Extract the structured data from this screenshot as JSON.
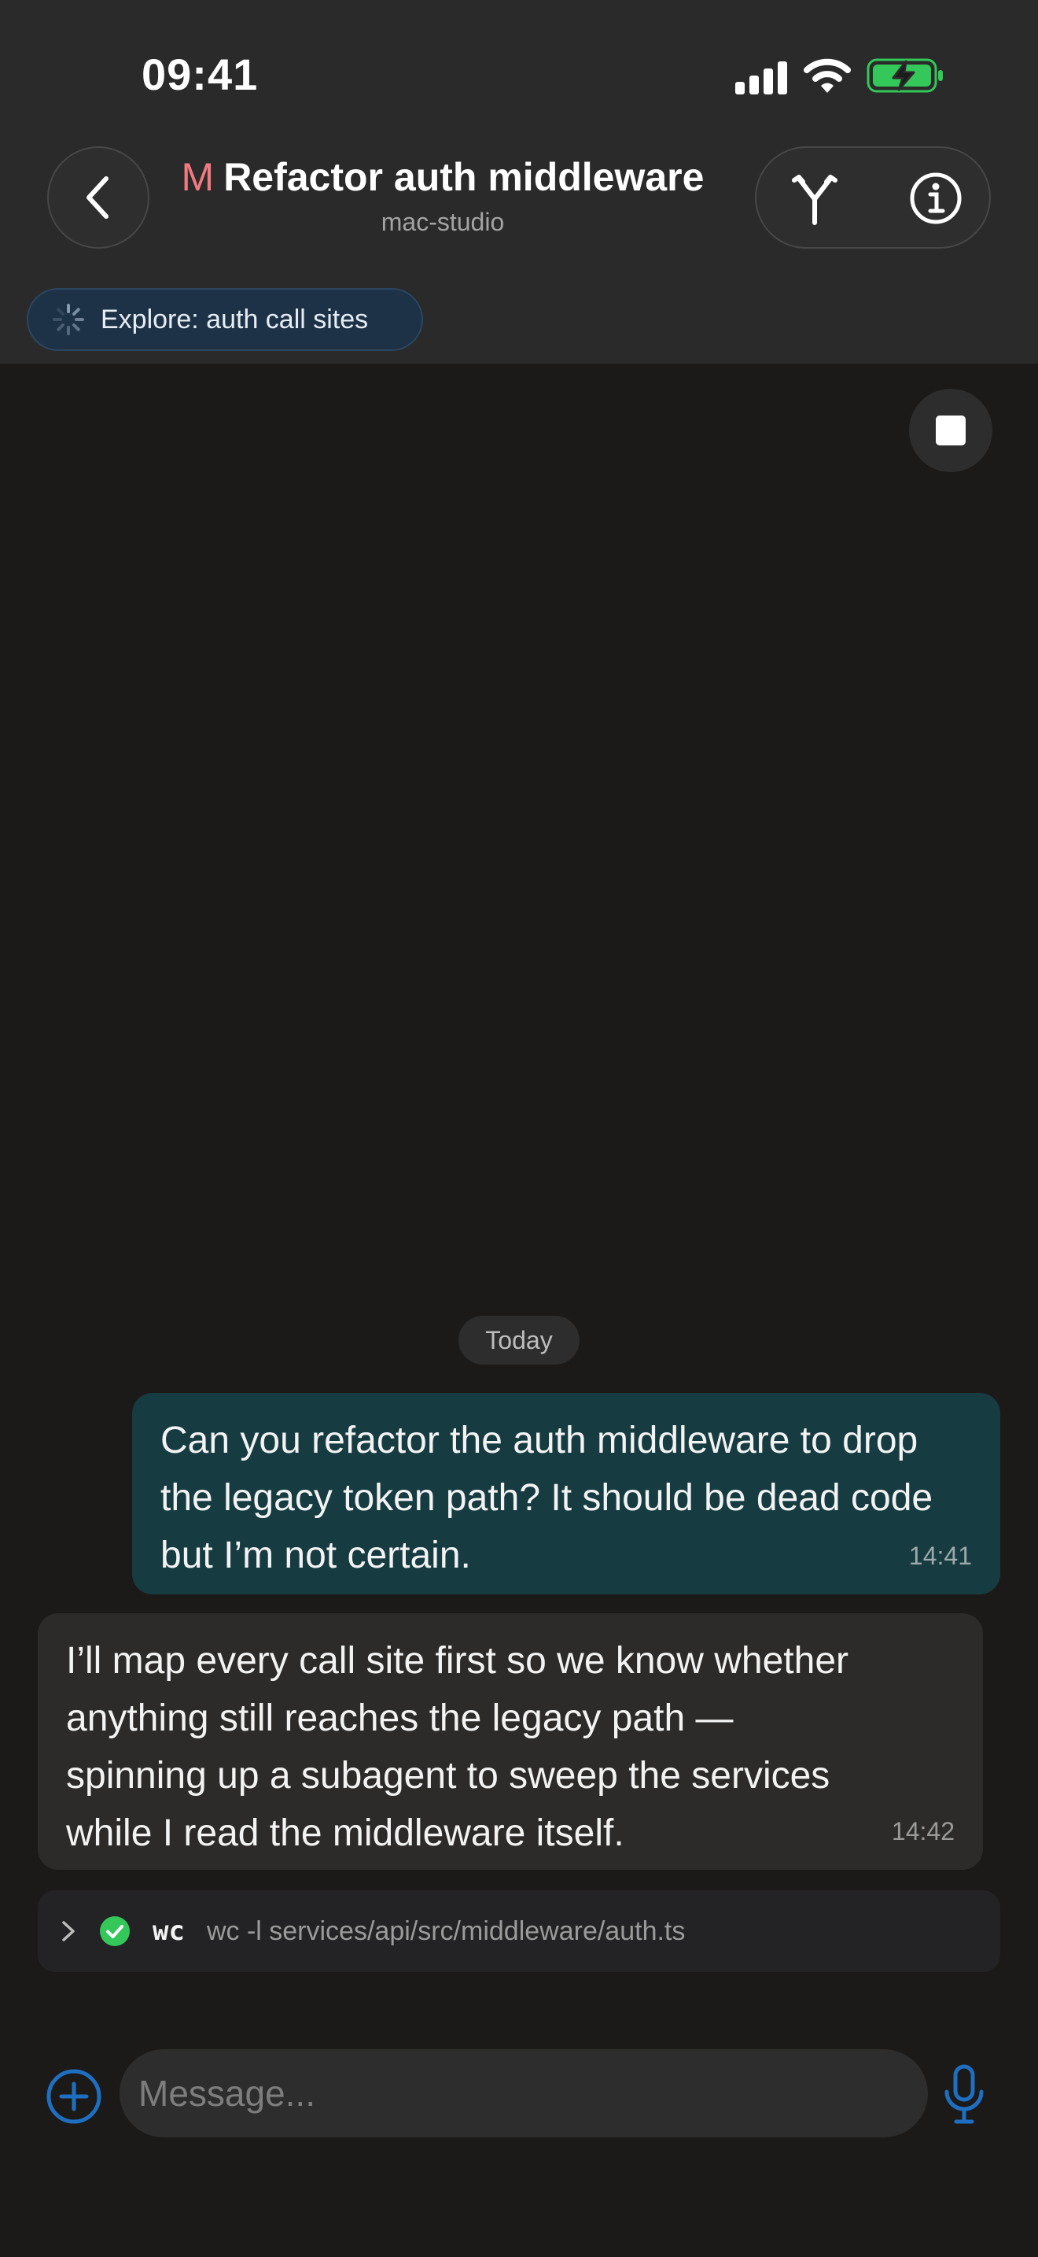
{
  "status_bar": {
    "time": "09:41",
    "icons": [
      "cellular-signal-icon",
      "wifi-icon",
      "battery-charging-icon"
    ]
  },
  "header": {
    "back_icon": "chevron-left-icon",
    "title_badge": "M",
    "title": "Refactor auth middleware",
    "subtitle": "mac-studio",
    "actions": [
      "branch-icon",
      "info-icon"
    ]
  },
  "subagent_chip": {
    "label": "Explore: auth call sites",
    "icon": "spinner-icon"
  },
  "conversation": {
    "date_separator": "Today",
    "messages": [
      {
        "role": "user",
        "text": "Can you refactor the auth middleware to drop the legacy token path? It should be dead code but I’m not certain.",
        "time": "14:41"
      },
      {
        "role": "assistant",
        "text": "I’ll map every call site first so we know whether anything still reaches the legacy path — spinning up a subagent to sweep the services while I read the middleware itself.",
        "time": "14:42"
      }
    ],
    "tool_call": {
      "status": "success",
      "name": "wc",
      "command": "wc -l services/api/src/middleware/auth.ts"
    }
  },
  "composer": {
    "placeholder": "Message...",
    "add_icon": "plus-circle-icon",
    "mic_icon": "microphone-icon"
  },
  "colors": {
    "background": "#1c1a18",
    "header": "#2a2a2a",
    "user_bubble": "#163c42",
    "assistant_bubble": "#2c2b29",
    "accent_blue": "#1e6fc1",
    "success_green": "#34c759",
    "badge_pink": "#f07a80",
    "battery_green": "#34c759"
  }
}
